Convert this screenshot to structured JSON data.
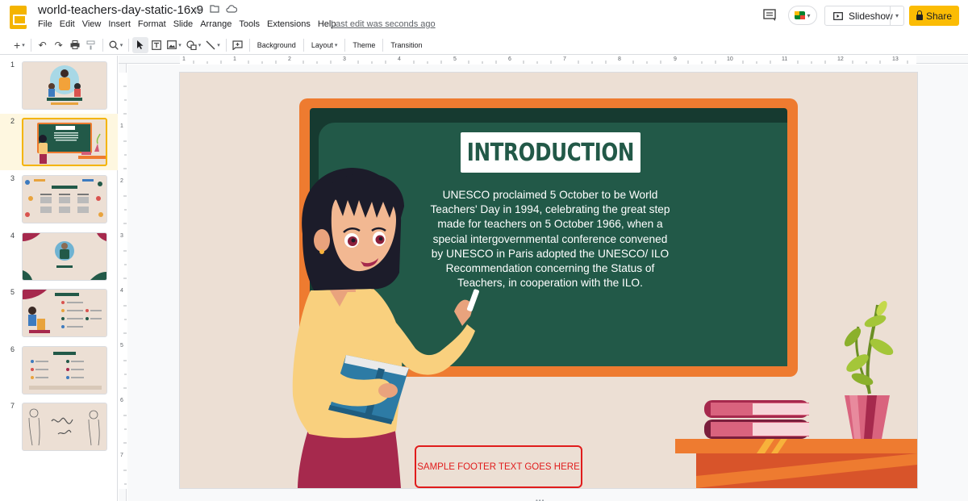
{
  "app": {
    "doc_title": "world-teachers-day-static-16x9",
    "menu": [
      "File",
      "Edit",
      "View",
      "Insert",
      "Format",
      "Slide",
      "Arrange",
      "Tools",
      "Extensions",
      "Help"
    ],
    "last_edit": "Last edit was seconds ago",
    "slideshow_label": "Slideshow",
    "share_label": "Share"
  },
  "toolbar": {
    "background_label": "Background",
    "layout_label": "Layout",
    "theme_label": "Theme",
    "transition_label": "Transition"
  },
  "filmstrip": {
    "selected": 2,
    "slides": [
      {
        "number": "1"
      },
      {
        "number": "2"
      },
      {
        "number": "3"
      },
      {
        "number": "4"
      },
      {
        "number": "5"
      },
      {
        "number": "6"
      },
      {
        "number": "7"
      }
    ]
  },
  "ruler": {
    "top": [
      "1",
      "1",
      "2",
      "3",
      "4",
      "5",
      "6",
      "7",
      "8",
      "9",
      "10",
      "11",
      "12",
      "13"
    ],
    "left": [
      "1",
      "2",
      "3",
      "4",
      "5",
      "6",
      "7"
    ]
  },
  "slide": {
    "title": "INTRODUCTION",
    "body": "UNESCO proclaimed 5 October to be World Teachers' Day in 1994, celebrating the great step made for teachers on 5 October 1966, when a special intergovernmental conference convened by UNESCO in Paris adopted the UNESCO/ ILO Recommendation concerning the Status of Teachers, in cooperation with the ILO.",
    "footer": "SAMPLE FOOTER TEXT GOES HERE"
  },
  "colors": {
    "accent": "#fbbc04",
    "board": "#225948",
    "frame": "#ee7b30",
    "footer": "#e01c1c",
    "slide_bg": "#ecdfd4"
  }
}
